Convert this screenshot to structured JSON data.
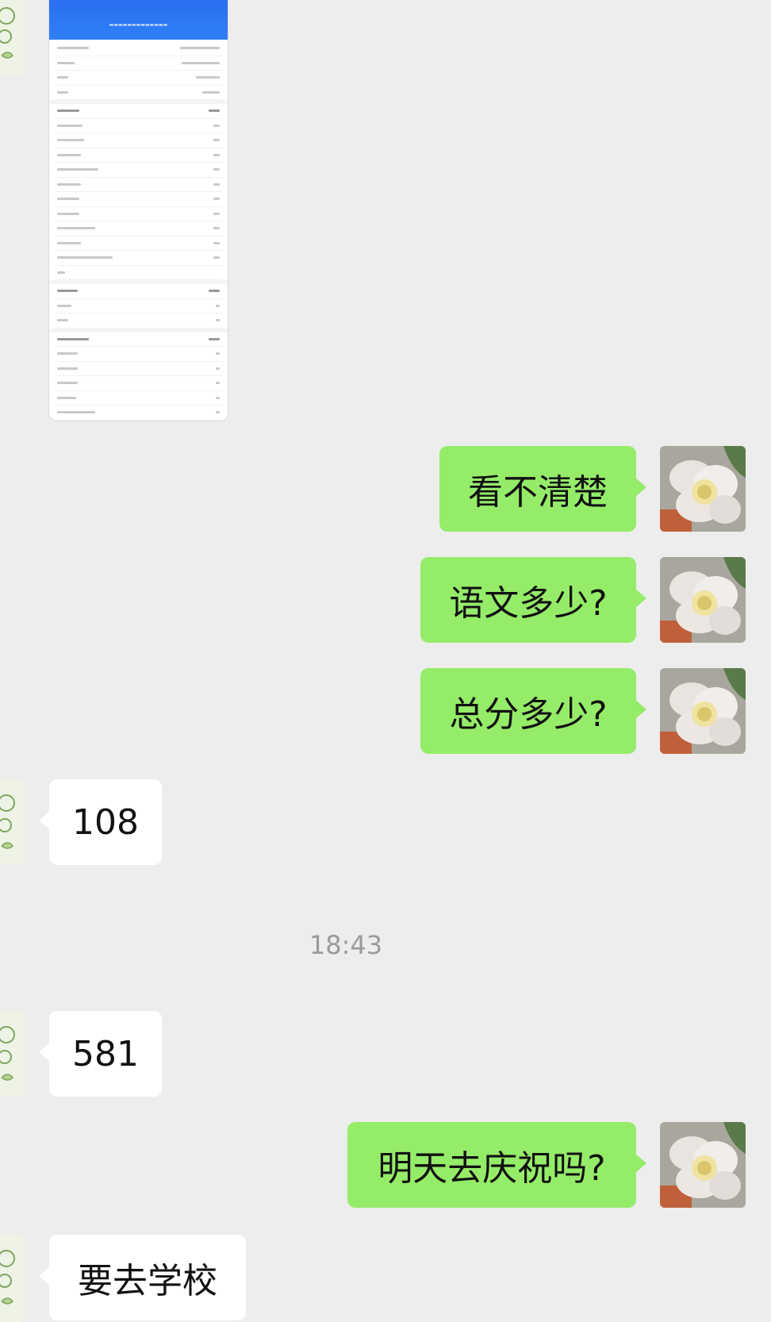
{
  "messages": {
    "sent_1": "看不清楚",
    "sent_2": "语文多少?",
    "sent_3": "总分多少?",
    "recv_1": "108",
    "timestamp": "18:43",
    "recv_2": "581",
    "sent_4": "明天去庆祝吗?",
    "recv_3": "要去学校"
  },
  "colors": {
    "background": "#ededed",
    "sent_bubble": "#95ec69",
    "received_bubble": "#ffffff",
    "screenshot_header": "#2f7ff6"
  },
  "icons": {
    "contact_avatar": "cartoon-avatar-icon",
    "self_avatar": "flower-photo-icon"
  }
}
